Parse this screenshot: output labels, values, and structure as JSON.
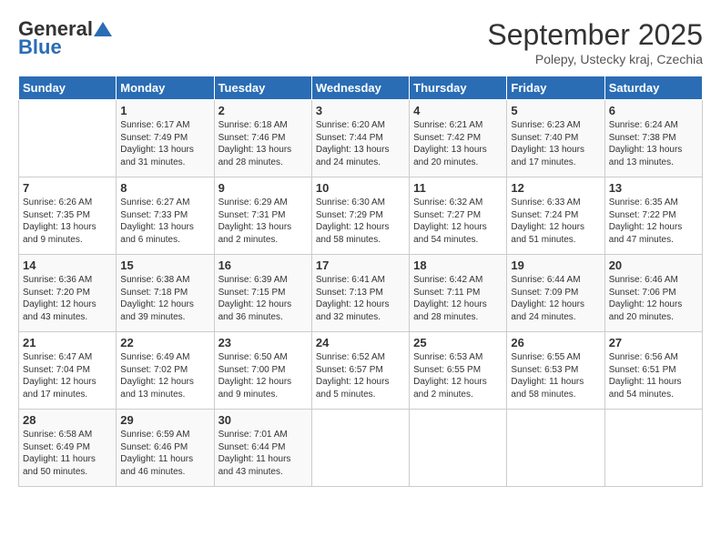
{
  "header": {
    "logo_general": "General",
    "logo_blue": "Blue",
    "month": "September 2025",
    "location": "Polepy, Ustecky kraj, Czechia"
  },
  "weekdays": [
    "Sunday",
    "Monday",
    "Tuesday",
    "Wednesday",
    "Thursday",
    "Friday",
    "Saturday"
  ],
  "weeks": [
    [
      {
        "day": "",
        "info": ""
      },
      {
        "day": "1",
        "info": "Sunrise: 6:17 AM\nSunset: 7:49 PM\nDaylight: 13 hours\nand 31 minutes."
      },
      {
        "day": "2",
        "info": "Sunrise: 6:18 AM\nSunset: 7:46 PM\nDaylight: 13 hours\nand 28 minutes."
      },
      {
        "day": "3",
        "info": "Sunrise: 6:20 AM\nSunset: 7:44 PM\nDaylight: 13 hours\nand 24 minutes."
      },
      {
        "day": "4",
        "info": "Sunrise: 6:21 AM\nSunset: 7:42 PM\nDaylight: 13 hours\nand 20 minutes."
      },
      {
        "day": "5",
        "info": "Sunrise: 6:23 AM\nSunset: 7:40 PM\nDaylight: 13 hours\nand 17 minutes."
      },
      {
        "day": "6",
        "info": "Sunrise: 6:24 AM\nSunset: 7:38 PM\nDaylight: 13 hours\nand 13 minutes."
      }
    ],
    [
      {
        "day": "7",
        "info": "Sunrise: 6:26 AM\nSunset: 7:35 PM\nDaylight: 13 hours\nand 9 minutes."
      },
      {
        "day": "8",
        "info": "Sunrise: 6:27 AM\nSunset: 7:33 PM\nDaylight: 13 hours\nand 6 minutes."
      },
      {
        "day": "9",
        "info": "Sunrise: 6:29 AM\nSunset: 7:31 PM\nDaylight: 13 hours\nand 2 minutes."
      },
      {
        "day": "10",
        "info": "Sunrise: 6:30 AM\nSunset: 7:29 PM\nDaylight: 12 hours\nand 58 minutes."
      },
      {
        "day": "11",
        "info": "Sunrise: 6:32 AM\nSunset: 7:27 PM\nDaylight: 12 hours\nand 54 minutes."
      },
      {
        "day": "12",
        "info": "Sunrise: 6:33 AM\nSunset: 7:24 PM\nDaylight: 12 hours\nand 51 minutes."
      },
      {
        "day": "13",
        "info": "Sunrise: 6:35 AM\nSunset: 7:22 PM\nDaylight: 12 hours\nand 47 minutes."
      }
    ],
    [
      {
        "day": "14",
        "info": "Sunrise: 6:36 AM\nSunset: 7:20 PM\nDaylight: 12 hours\nand 43 minutes."
      },
      {
        "day": "15",
        "info": "Sunrise: 6:38 AM\nSunset: 7:18 PM\nDaylight: 12 hours\nand 39 minutes."
      },
      {
        "day": "16",
        "info": "Sunrise: 6:39 AM\nSunset: 7:15 PM\nDaylight: 12 hours\nand 36 minutes."
      },
      {
        "day": "17",
        "info": "Sunrise: 6:41 AM\nSunset: 7:13 PM\nDaylight: 12 hours\nand 32 minutes."
      },
      {
        "day": "18",
        "info": "Sunrise: 6:42 AM\nSunset: 7:11 PM\nDaylight: 12 hours\nand 28 minutes."
      },
      {
        "day": "19",
        "info": "Sunrise: 6:44 AM\nSunset: 7:09 PM\nDaylight: 12 hours\nand 24 minutes."
      },
      {
        "day": "20",
        "info": "Sunrise: 6:46 AM\nSunset: 7:06 PM\nDaylight: 12 hours\nand 20 minutes."
      }
    ],
    [
      {
        "day": "21",
        "info": "Sunrise: 6:47 AM\nSunset: 7:04 PM\nDaylight: 12 hours\nand 17 minutes."
      },
      {
        "day": "22",
        "info": "Sunrise: 6:49 AM\nSunset: 7:02 PM\nDaylight: 12 hours\nand 13 minutes."
      },
      {
        "day": "23",
        "info": "Sunrise: 6:50 AM\nSunset: 7:00 PM\nDaylight: 12 hours\nand 9 minutes."
      },
      {
        "day": "24",
        "info": "Sunrise: 6:52 AM\nSunset: 6:57 PM\nDaylight: 12 hours\nand 5 minutes."
      },
      {
        "day": "25",
        "info": "Sunrise: 6:53 AM\nSunset: 6:55 PM\nDaylight: 12 hours\nand 2 minutes."
      },
      {
        "day": "26",
        "info": "Sunrise: 6:55 AM\nSunset: 6:53 PM\nDaylight: 11 hours\nand 58 minutes."
      },
      {
        "day": "27",
        "info": "Sunrise: 6:56 AM\nSunset: 6:51 PM\nDaylight: 11 hours\nand 54 minutes."
      }
    ],
    [
      {
        "day": "28",
        "info": "Sunrise: 6:58 AM\nSunset: 6:49 PM\nDaylight: 11 hours\nand 50 minutes."
      },
      {
        "day": "29",
        "info": "Sunrise: 6:59 AM\nSunset: 6:46 PM\nDaylight: 11 hours\nand 46 minutes."
      },
      {
        "day": "30",
        "info": "Sunrise: 7:01 AM\nSunset: 6:44 PM\nDaylight: 11 hours\nand 43 minutes."
      },
      {
        "day": "",
        "info": ""
      },
      {
        "day": "",
        "info": ""
      },
      {
        "day": "",
        "info": ""
      },
      {
        "day": "",
        "info": ""
      }
    ]
  ]
}
